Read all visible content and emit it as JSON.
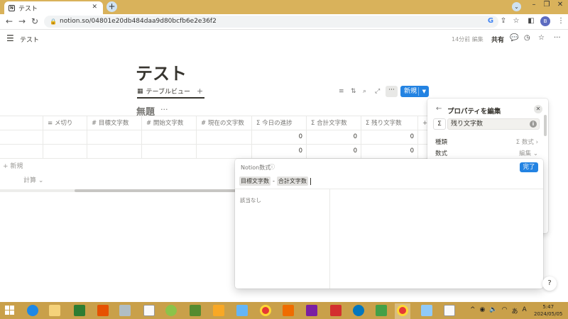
{
  "browser": {
    "tab_title": "テスト",
    "url": "notion.so/04801e20db484daa9d80bcfb6e2e36f2",
    "profile_initial": "B"
  },
  "notion": {
    "breadcrumb": "テスト",
    "edited_status": "14分前 編集",
    "share_label": "共有",
    "page_title": "テスト",
    "view_name": "テーブルビュー",
    "new_button": "新規",
    "db_title": "無題",
    "columns": [
      "メ切り",
      "目標文字数",
      "開始文字数",
      "現在の文字数",
      "今日の進捗",
      "合計文字数",
      "残り文字数"
    ],
    "column_icons": [
      "≡",
      "#",
      "#",
      "#",
      "Σ",
      "Σ",
      "Σ"
    ],
    "rows": [
      {
        "today": "0",
        "total": "0",
        "remaining": "0"
      },
      {
        "today": "0",
        "total": "0",
        "remaining": "0"
      }
    ],
    "add_row_label": "新規",
    "calc_label": "計算"
  },
  "property_panel": {
    "title": "プロパティを編集",
    "property_name": "残り文字数",
    "type_label": "種類",
    "type_value": "数式",
    "formula_label": "数式",
    "formula_value": "編集"
  },
  "formula_editor": {
    "title": "Notion数式",
    "done_label": "完了",
    "tokens": [
      "目標文字数",
      "-",
      "合計文字数"
    ],
    "empty_text": "該当なし"
  },
  "taskbar": {
    "ime": "あ",
    "time": "5:47",
    "date": "2024/05/05"
  },
  "colors": {
    "browser_frame": "#d9b25b",
    "accent_blue": "#2383e2",
    "taskbar": "#c9a04a"
  }
}
